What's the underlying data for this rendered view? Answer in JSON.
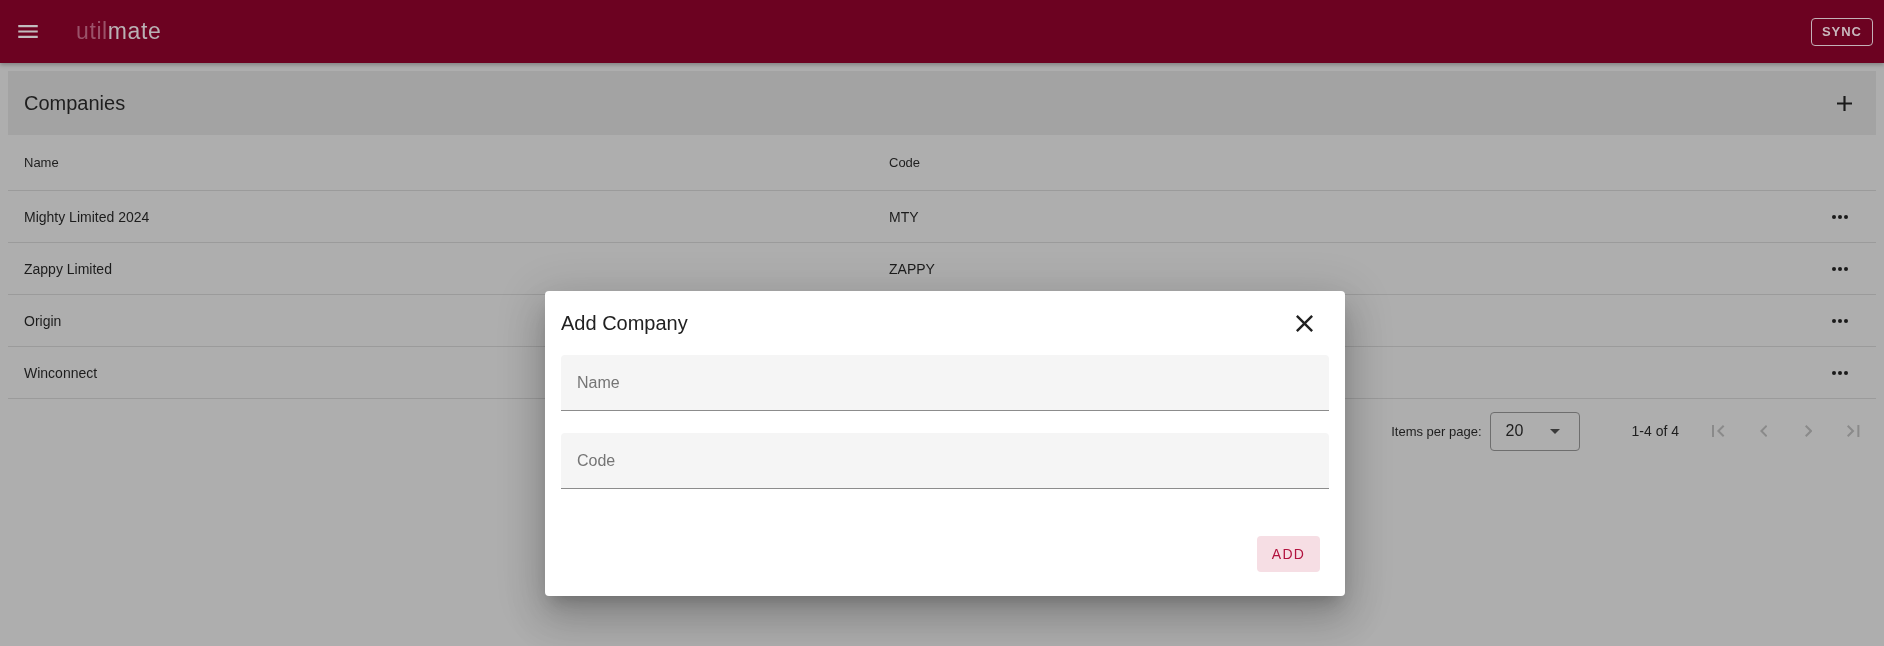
{
  "app_bar": {
    "logo": {
      "lead": "util",
      "rest": "mate"
    },
    "sync_button": "SYNC"
  },
  "page": {
    "title": "Companies"
  },
  "table": {
    "columns": [
      "Name",
      "Code"
    ],
    "rows": [
      {
        "name": "Mighty Limited 2024",
        "code": "MTY"
      },
      {
        "name": "Zappy Limited",
        "code": "ZAPPY"
      },
      {
        "name": "Origin"
      },
      {
        "name": "Winconnect"
      }
    ]
  },
  "paginator": {
    "label": "Items per page:",
    "page_size": "20",
    "range": "1-4 of 4",
    "buttons": [
      {
        "kind": "first",
        "disabled": true
      },
      {
        "kind": "previous",
        "disabled": true
      },
      {
        "kind": "next",
        "disabled": true
      },
      {
        "kind": "last",
        "disabled": true
      }
    ]
  },
  "dialog": {
    "title": "Add Company",
    "fields": [
      {
        "placeholder": "Name"
      },
      {
        "placeholder": "Code"
      }
    ],
    "submit": "ADD"
  }
}
